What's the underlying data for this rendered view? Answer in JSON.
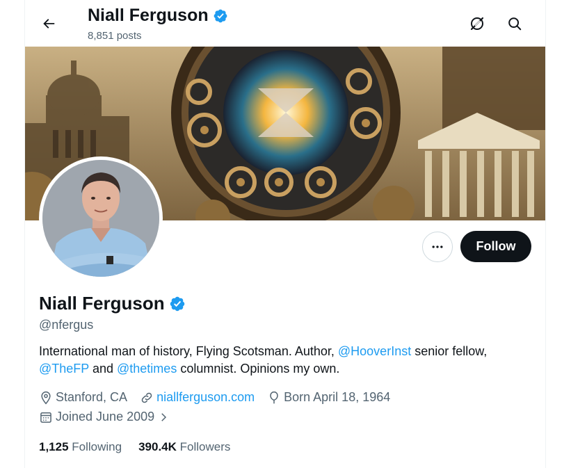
{
  "header": {
    "title": "Niall Ferguson",
    "posts": "8,851 posts"
  },
  "profile": {
    "name": "Niall Ferguson",
    "handle": "@nfergus",
    "bio": {
      "part1": "International man of history, Flying Scotsman. Author, ",
      "mention1": "@HooverInst",
      "part2": " senior fellow, ",
      "mention2": "@TheFP",
      "part3": " and ",
      "mention3": "@thetimes",
      "part4": " columnist. Opinions my own."
    },
    "location": "Stanford, CA",
    "website": "niallferguson.com",
    "birthday": "Born April 18, 1964",
    "joined": "Joined June 2009",
    "following_count": "1,125",
    "following_label": "Following",
    "followers_count": "390.4K",
    "followers_label": "Followers"
  },
  "actions": {
    "follow_label": "Follow"
  },
  "colors": {
    "accent": "#1d9bf0",
    "text": "#0f1419",
    "secondary": "#536471",
    "verified": "#1d9bf0"
  },
  "icons": [
    "back-arrow-icon",
    "grok-icon",
    "search-icon",
    "verified-badge-icon",
    "more-icon",
    "location-icon",
    "link-icon",
    "balloon-icon",
    "calendar-icon",
    "chevron-right-icon"
  ]
}
